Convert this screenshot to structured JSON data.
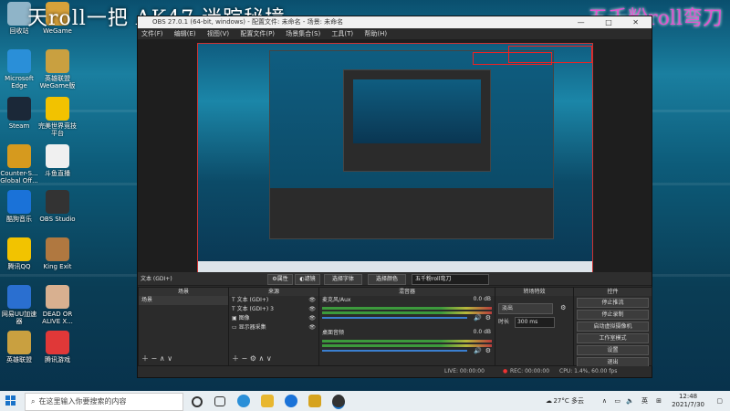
{
  "overlay": {
    "left_text": "天roll一把 AK47 迷踪秘境",
    "right_text": "五千粉roll弯刀"
  },
  "desktop_icons": [
    {
      "label": "回收站",
      "color": "#8fb4c8"
    },
    {
      "label": "WeGame",
      "color": "#d8a23a"
    },
    {
      "label": "Microsoft Edge",
      "color": "#2a8fd8"
    },
    {
      "label": "英雄联盟 WeGame版",
      "color": "#c9a040"
    },
    {
      "label": "Steam",
      "color": "#1b2838"
    },
    {
      "label": "完美世界竞技平台",
      "color": "#f2c200"
    },
    {
      "label": "Counter-S... Global Off...",
      "color": "#d69a1e"
    },
    {
      "label": "斗鱼直播",
      "color": "#f0f0f0"
    },
    {
      "label": "酷狗音乐",
      "color": "#1a72d8"
    },
    {
      "label": "OBS Studio",
      "color": "#333"
    },
    {
      "label": "腾讯QQ",
      "color": "#f2c300"
    },
    {
      "label": "King Exit",
      "color": "#b07840"
    },
    {
      "label": "网易UU加速器",
      "color": "#2a6fd0"
    },
    {
      "label": "DEAD OR ALIVE X...",
      "color": "#d8b090"
    },
    {
      "label": "英雄联盟",
      "color": "#c9a040"
    },
    {
      "label": "腾讯游戏",
      "color": "#e03838"
    }
  ],
  "obs": {
    "title": "OBS 27.0.1 (64-bit, windows) - 配置文件: 未命名 - 场景: 未命名",
    "window_buttons": [
      "—",
      "□",
      "✕"
    ],
    "menu": [
      "文件(F)",
      "编辑(E)",
      "视图(V)",
      "配置文件(P)",
      "场景集合(S)",
      "工具(T)",
      "帮助(H)"
    ],
    "source_label": "文本 (GDI+)",
    "toolbar": {
      "properties": "属性",
      "filters": "滤镜",
      "select_font": "选择字体",
      "select_font2": "选择颜色",
      "text_value": "五千粉roll弯刀"
    },
    "scenes": {
      "header": "场景",
      "items": [
        "场景"
      ]
    },
    "sources": {
      "header": "来源",
      "items": [
        {
          "label": "文本 (GDI+)",
          "icon": "text-icon"
        },
        {
          "label": "文本 (GDI+) 3",
          "icon": "text-icon"
        },
        {
          "label": "图像",
          "icon": "image-icon"
        },
        {
          "label": "显示器采集",
          "icon": "monitor-icon"
        }
      ]
    },
    "mixer": {
      "header": "混音器",
      "channels": [
        {
          "name": "麦克风/Aux",
          "db": "0.0 dB"
        },
        {
          "name": "桌面音频",
          "db": "0.0 dB"
        }
      ]
    },
    "transitions": {
      "header": "转场特效",
      "type": "淡出",
      "duration_label": "时长",
      "duration_value": "300 ms"
    },
    "controls": {
      "header": "控件",
      "buttons": [
        "停止推流",
        "停止录制",
        "启动虚拟摄像机",
        "工作室模式",
        "设置",
        "退出"
      ]
    },
    "status": {
      "live": "LIVE: 00:00:00",
      "rec": "REC: 00:00:00",
      "cpu": "CPU: 1.4%, 60.00 fps"
    }
  },
  "taskbar": {
    "search_placeholder": "在这里输入你要搜索的内容",
    "weather": "27°C 多云",
    "ime": "英",
    "time": "12:48",
    "date": "2021/7/30",
    "accent": "#1a73c9"
  }
}
